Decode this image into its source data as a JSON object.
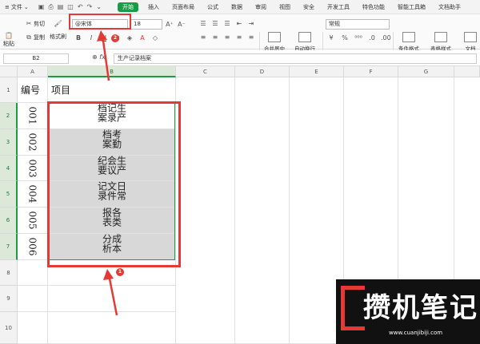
{
  "menubar": {
    "file": "文件",
    "tabs": [
      "开始",
      "插入",
      "页面布局",
      "公式",
      "数据",
      "审阅",
      "视图",
      "安全",
      "开发工具",
      "特色功能",
      "智能工具箱",
      "文档助手"
    ]
  },
  "ribbon": {
    "paste": "粘贴",
    "cut": "剪切",
    "copy": "复制",
    "format_painter": "格式刷",
    "font_name": "@宋体",
    "font_size": "18",
    "merge": "合并居中",
    "wrap": "自动换行",
    "number_format": "常规",
    "percent": "%",
    "cond_format": "条件格式",
    "table_style": "表格样式",
    "doc_helper": "文档"
  },
  "formula_bar": {
    "name_box": "B2",
    "fx": "fx",
    "value": "生产记录档案"
  },
  "columns": [
    "A",
    "B",
    "C",
    "D",
    "E",
    "F",
    "G"
  ],
  "rows": [
    "1",
    "2",
    "3",
    "4",
    "5",
    "6",
    "7",
    "8",
    "9",
    "10"
  ],
  "sheet": {
    "header_a": "编号",
    "header_b": "项目",
    "items": [
      {
        "num": "001",
        "text": "生产记录档案"
      },
      {
        "num": "002",
        "text": "考勤档案"
      },
      {
        "num": "003",
        "text": "生产会议纪要"
      },
      {
        "num": "004",
        "text": "日常文件记录"
      },
      {
        "num": "005",
        "text": "各类报表"
      },
      {
        "num": "006",
        "text": "成本分析"
      }
    ]
  },
  "annotations": {
    "badge1": "1",
    "badge2": "2"
  },
  "watermark": {
    "title": "攒机笔记",
    "url": "www.cuanjibiji.com"
  },
  "colors": {
    "accent": "#1a9c47",
    "highlight": "#e53935"
  }
}
